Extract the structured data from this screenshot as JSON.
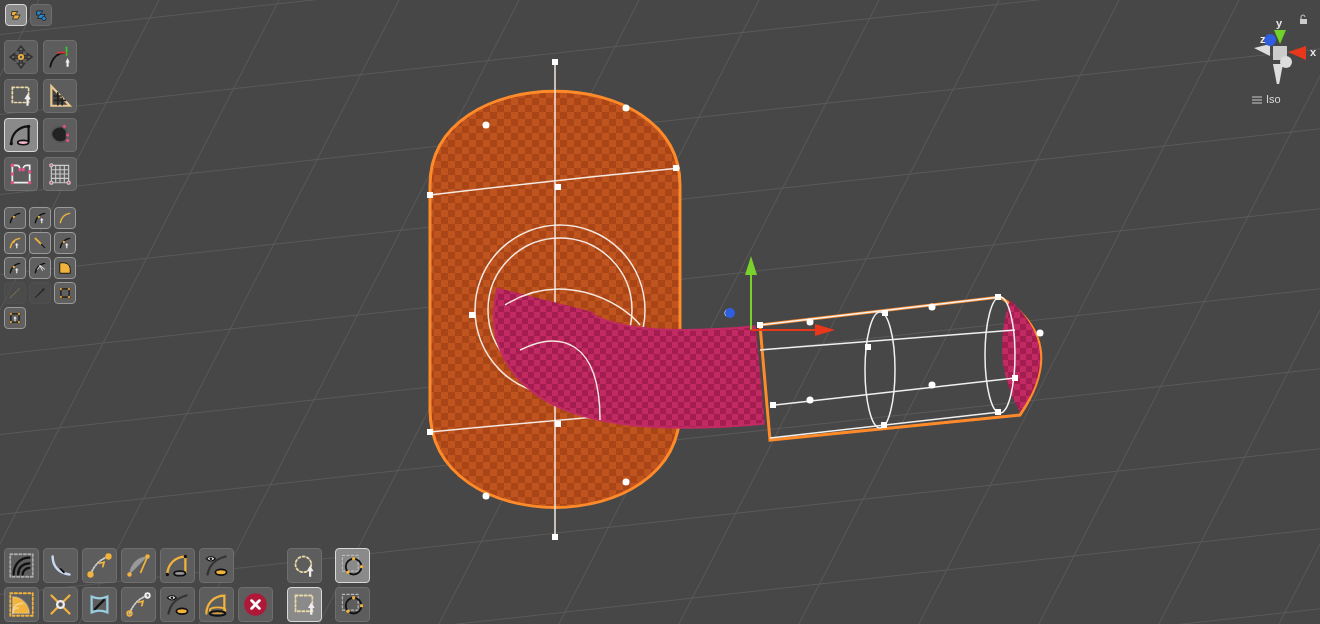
{
  "toolbar_top": [
    {
      "kind": "spline-shape",
      "selected": true
    },
    {
      "kind": "spline-add",
      "selected": false
    }
  ],
  "tools": [
    {
      "kind": "move",
      "selected": false
    },
    {
      "kind": "curve-arrow",
      "selected": false
    },
    {
      "kind": "rect-select",
      "selected": false
    },
    {
      "kind": "ruler-triangle",
      "selected": false
    },
    {
      "kind": "arc-edit",
      "selected": true
    },
    {
      "kind": "bowl",
      "selected": false
    },
    {
      "kind": "shape-points",
      "selected": false
    },
    {
      "kind": "grid",
      "selected": false
    }
  ],
  "segment_tools": [
    {
      "kind": "curve-point",
      "disabled": false
    },
    {
      "kind": "curve-point-up",
      "disabled": false
    },
    {
      "kind": "curve-thick",
      "disabled": false
    },
    {
      "kind": "curve-thick-up",
      "disabled": false
    },
    {
      "kind": "segment-tilt",
      "disabled": false
    },
    {
      "kind": "curve-handle-up",
      "disabled": false
    },
    {
      "kind": "curve-up",
      "disabled": false
    },
    {
      "kind": "curve-fan",
      "disabled": false
    },
    {
      "kind": "fill-corner",
      "disabled": false
    },
    {
      "kind": "dotted-line",
      "disabled": true
    },
    {
      "kind": "line",
      "disabled": true
    },
    {
      "kind": "square-points",
      "disabled": false
    },
    {
      "kind": "square-points-up",
      "disabled": false
    }
  ],
  "bottom_tools": [
    [
      {
        "kind": "arcs-select",
        "selected": false
      },
      {
        "kind": "curve-slash",
        "selected": false
      },
      {
        "kind": "curve-dots",
        "selected": false
      },
      {
        "kind": "sector",
        "selected": false
      },
      {
        "kind": "arc-edit-outline",
        "selected": false
      },
      {
        "kind": "eye-curve",
        "selected": false
      }
    ],
    [
      {
        "kind": "quarter-fill",
        "selected": false
      },
      {
        "kind": "scatter-arrows",
        "selected": false
      },
      {
        "kind": "warp-rect",
        "selected": false
      },
      {
        "kind": "curve-dots-down",
        "selected": false
      },
      {
        "kind": "eye-arc",
        "selected": false
      },
      {
        "kind": "arc-rings",
        "selected": false
      },
      {
        "kind": "delete",
        "selected": false
      }
    ]
  ],
  "selection_tools": [
    [
      {
        "kind": "circle-select-up",
        "selected": false
      },
      {
        "kind": "circle-rect",
        "selected": true
      }
    ],
    [
      {
        "kind": "rect-select",
        "selected": true
      },
      {
        "kind": "circle-rect",
        "selected": false
      }
    ]
  ],
  "gizmo": {
    "axes": [
      {
        "label": "y",
        "color": "#6fd12a"
      },
      {
        "label": "z",
        "color": "#2f5fe0"
      },
      {
        "label": "x",
        "color": "#e8381c"
      }
    ],
    "view": "Iso"
  }
}
